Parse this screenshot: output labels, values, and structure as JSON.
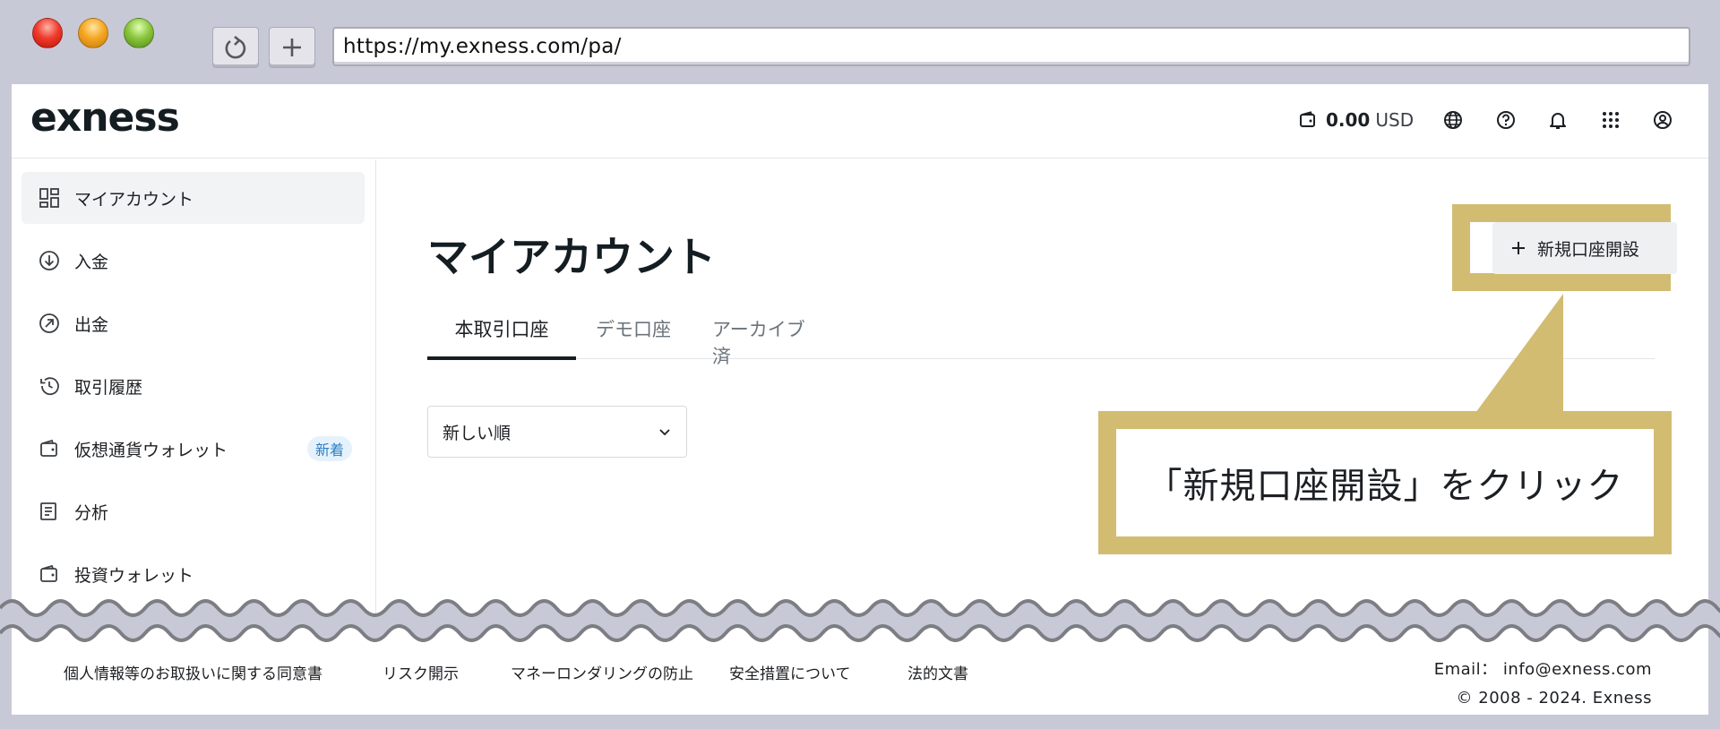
{
  "browser": {
    "url": "https://my.exness.com/pa/"
  },
  "header": {
    "logo": "exness",
    "balance_amount": "0.00",
    "balance_currency": "USD"
  },
  "sidebar": {
    "items": [
      {
        "label": "マイアカウント",
        "icon": "dashboard-icon",
        "active": true
      },
      {
        "label": "入金",
        "icon": "deposit-icon"
      },
      {
        "label": "出金",
        "icon": "withdraw-icon"
      },
      {
        "label": "取引履歴",
        "icon": "history-icon"
      },
      {
        "label": "仮想通貨ウォレット",
        "icon": "wallet-icon",
        "badge": "新着"
      },
      {
        "label": "分析",
        "icon": "analytics-icon"
      },
      {
        "label": "投資ウォレット",
        "icon": "wallet-icon"
      }
    ]
  },
  "main": {
    "title": "マイアカウント",
    "new_account_button": "新規口座開設",
    "tabs": [
      {
        "label": "本取引口座",
        "active": true
      },
      {
        "label": "デモ口座"
      },
      {
        "label": "アーカイブ済"
      }
    ],
    "sort_value": "新しい順"
  },
  "annotation": {
    "callout_text": "「新規口座開設」をクリック",
    "highlight_color": "#d2bc72"
  },
  "footer": {
    "links": [
      "個人情報等のお取扱いに関する同意書",
      "リスク開示",
      "マネーロンダリングの防止",
      "安全措置について",
      "法的文書"
    ],
    "email_label": "Email：",
    "email": "info@exness.com",
    "copyright": "© 2008 - 2024. Exness"
  }
}
